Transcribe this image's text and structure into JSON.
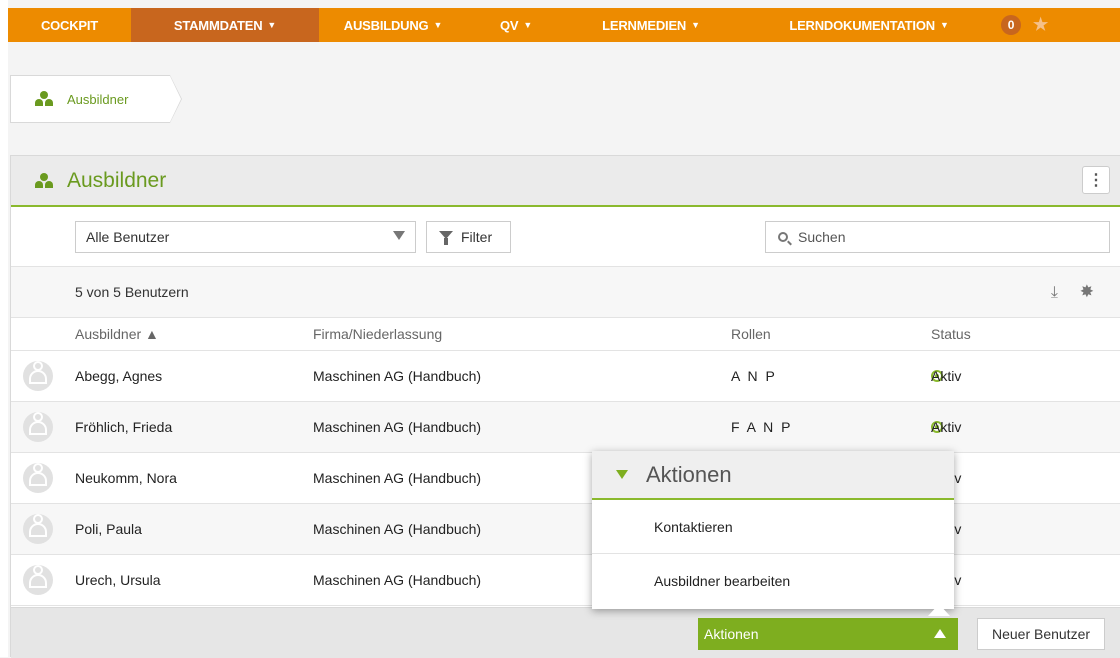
{
  "nav": {
    "items": [
      {
        "label": "COCKPIT",
        "dropdown": false,
        "active": false
      },
      {
        "label": "STAMMDATEN",
        "dropdown": true,
        "active": true
      },
      {
        "label": "AUSBILDUNG",
        "dropdown": true,
        "active": false
      },
      {
        "label": "QV",
        "dropdown": true,
        "active": false
      },
      {
        "label": "LERNMEDIEN",
        "dropdown": true,
        "active": false
      },
      {
        "label": "LERNDOKUMENTATION",
        "dropdown": true,
        "active": false
      }
    ],
    "notification_count": "0",
    "caret": "▼",
    "star": "★"
  },
  "breadcrumb": {
    "label": "Ausbildner",
    "icon": "users-icon"
  },
  "panel": {
    "title": "Ausbildner",
    "menu_icon": "⋮",
    "filter_select": "Alle Benutzer",
    "filter_button": "Filter",
    "search_placeholder": "Suchen",
    "count_text": "5 von 5 Benutzern"
  },
  "table": {
    "headers": {
      "name": "Ausbildner ▲",
      "firma": "Firma/Niederlassung",
      "rollen": "Rollen",
      "status": "Status"
    },
    "rows": [
      {
        "name": "Abegg, Agnes",
        "firma": "Maschinen AG (Handbuch)",
        "rollen": "A N P",
        "status": "Aktiv"
      },
      {
        "name": "Fröhlich, Frieda",
        "firma": "Maschinen AG (Handbuch)",
        "rollen": "F A N P",
        "status": "Aktiv"
      },
      {
        "name": "Neukomm, Nora",
        "firma": "Maschinen AG (Handbuch)",
        "rollen": "",
        "status": "Aktiv"
      },
      {
        "name": "Poli, Paula",
        "firma": "Maschinen AG (Handbuch)",
        "rollen": "",
        "status": "Aktiv"
      },
      {
        "name": "Urech, Ursula",
        "firma": "Maschinen AG (Handbuch)",
        "rollen": "",
        "status": "Aktiv"
      }
    ]
  },
  "footer": {
    "aktionen_button": "Aktionen",
    "new_user_button": "Neuer Benutzer"
  },
  "popup": {
    "title": "Aktionen",
    "items": [
      "Kontaktieren",
      "Ausbildner bearbeiten"
    ]
  },
  "colors": {
    "nav_bg": "#ed8b00",
    "nav_active": "#c8661e",
    "accent_green": "#7eae1f"
  }
}
